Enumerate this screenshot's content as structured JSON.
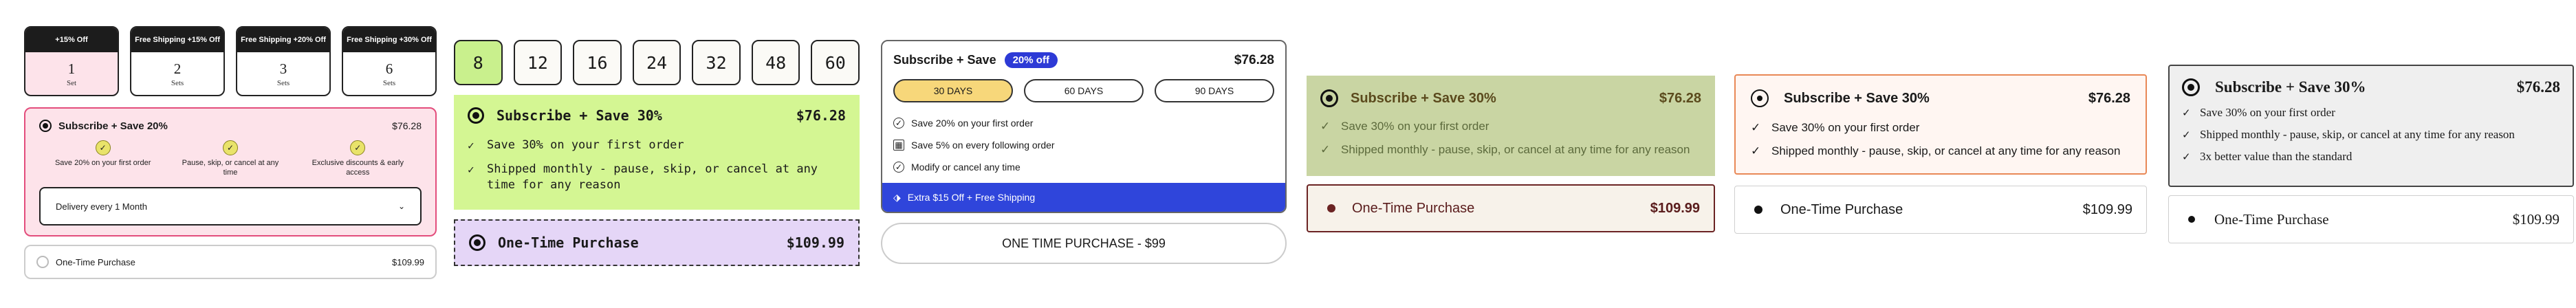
{
  "panel1": {
    "packs": [
      {
        "badge": "+15% Off",
        "count": "1",
        "unit": "Set"
      },
      {
        "badge": "Free Shipping +15% Off",
        "count": "2",
        "unit": "Sets"
      },
      {
        "badge": "Free Shipping +20% Off",
        "count": "3",
        "unit": "Sets"
      },
      {
        "badge": "Free Shipping +30% Off",
        "count": "6",
        "unit": "Sets"
      }
    ],
    "subscribe_label": "Subscribe + Save 20%",
    "subscribe_price": "$76.28",
    "benefits": [
      "Save 20% on your first order",
      "Pause, skip, or cancel at any time",
      "Exclusive discounts & early access"
    ],
    "delivery_value": "Delivery every 1 Month",
    "onetime_label": "One-Time Purchase",
    "onetime_price": "$109.99"
  },
  "panel2": {
    "sizes": [
      "8",
      "12",
      "16",
      "24",
      "32",
      "48",
      "60"
    ],
    "subscribe_label": "Subscribe + Save 30%",
    "subscribe_price": "$76.28",
    "benefits": [
      "Save 30% on your first order",
      "Shipped monthly - pause, skip, or cancel at any time for any reason"
    ],
    "onetime_label": "One-Time Purchase",
    "onetime_price": "$109.99"
  },
  "panel3": {
    "subscribe_label": "Subscribe + Save",
    "badge": "20% off",
    "subscribe_price": "$76.28",
    "tabs": [
      "30 DAYS",
      "60 DAYS",
      "90 DAYS"
    ],
    "benefits": [
      "Save 20% on your first order",
      "Save 5% on every following order",
      "Modify or cancel any time"
    ],
    "promo": "Extra $15 Off + Free Shipping",
    "onetime_label": "ONE TIME PURCHASE - $99"
  },
  "panel4": {
    "subscribe_label": "Subscribe + Save 30%",
    "subscribe_price": "$76.28",
    "benefits": [
      "Save 30% on your first order",
      "Shipped monthly - pause, skip, or cancel at any time for any reason"
    ],
    "onetime_label": "One-Time Purchase",
    "onetime_price": "$109.99"
  },
  "panel5": {
    "subscribe_label": "Subscribe + Save 30%",
    "subscribe_price": "$76.28",
    "benefits": [
      "Save 30% on your first order",
      "Shipped monthly - pause, skip, or cancel at any time for any reason"
    ],
    "onetime_label": "One-Time Purchase",
    "onetime_price": "$109.99"
  },
  "panel6": {
    "subscribe_label": "Subscribe + Save 30%",
    "subscribe_price": "$76.28",
    "benefits": [
      "Save 30% on your first order",
      "Shipped monthly - pause, skip, or cancel at any time for any reason",
      "3x better value than the standard"
    ],
    "onetime_label": "One-Time Purchase",
    "onetime_price": "$109.99"
  },
  "icons": {
    "radio": "radio-icon",
    "check": "check-icon",
    "chevron": "chevron-down-icon",
    "tag": "tag-icon",
    "calendar": "calendar-icon"
  },
  "colors": {
    "pink": "#fde3ea",
    "green": "#d4f693",
    "purple": "#e5d6f7",
    "blue": "#2f45db",
    "olive": "#c9d5a3",
    "orange": "#e98856"
  }
}
